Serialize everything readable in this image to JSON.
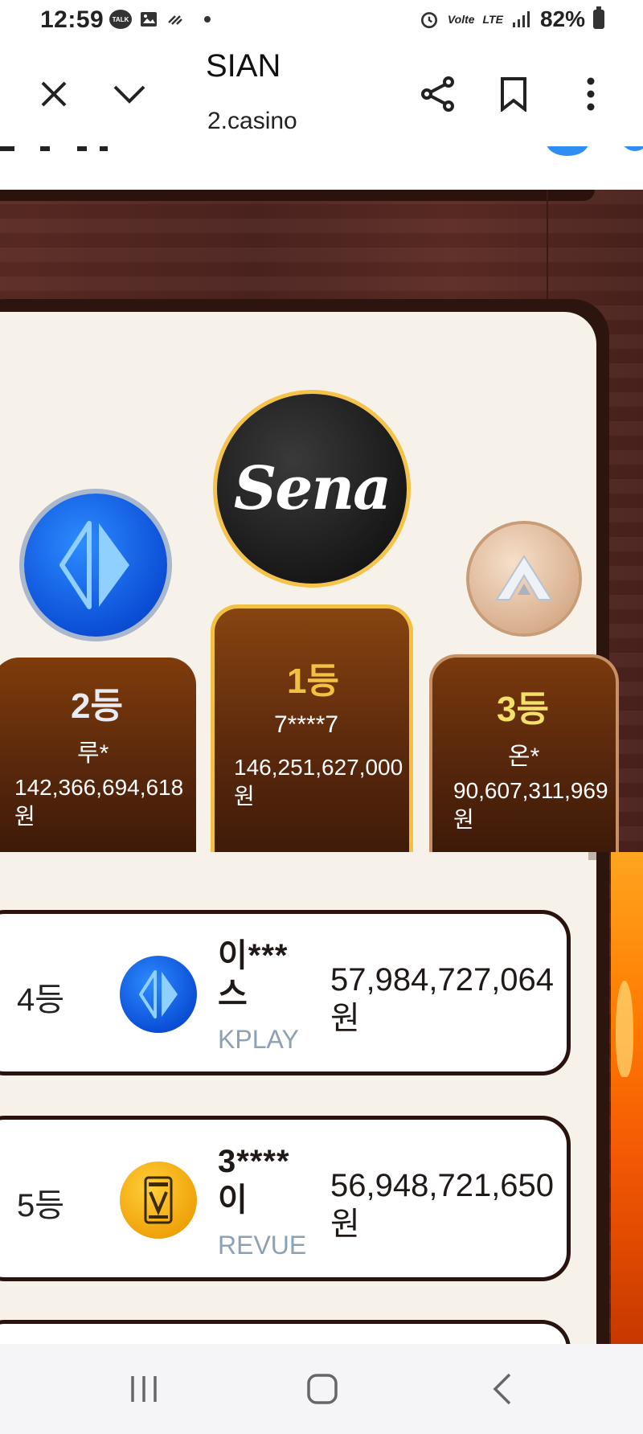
{
  "status_bar": {
    "time": "12:59",
    "talk_badge": "TALK",
    "volte": "Volte",
    "lte": "LTE",
    "battery": "82%"
  },
  "browser": {
    "title": "SIAN",
    "url": "2.casino",
    "icons": [
      "close-icon",
      "chevron-down-icon",
      "share-icon",
      "bookmark-icon",
      "more-vert-icon"
    ]
  },
  "podium": {
    "second": {
      "rank": "2등",
      "name": "루*",
      "amount": "142,366,694,618\n원",
      "provider_icon": "kplay-logo"
    },
    "first": {
      "rank": "1등",
      "name": "7****7",
      "amount": "146,251,627,000\n원",
      "logo_text": "Sena"
    },
    "third": {
      "rank": "3등",
      "name": "온*",
      "amount": "90,607,311,969\n원",
      "provider_icon": "a-logo"
    }
  },
  "rankings": [
    {
      "rank": "4등",
      "name": "이***\n스",
      "provider": "KPLAY",
      "amount": "57,984,727,064\n원"
    },
    {
      "rank": "5등",
      "name": "3****\n이",
      "provider": "REVUE",
      "amount": "56,948,721,650\n원"
    }
  ],
  "colors": {
    "gold": "#f2c144",
    "panel_bg": "#f6f1e9",
    "dark_brown": "#2c150f",
    "provider_text": "#8ea0b3"
  }
}
